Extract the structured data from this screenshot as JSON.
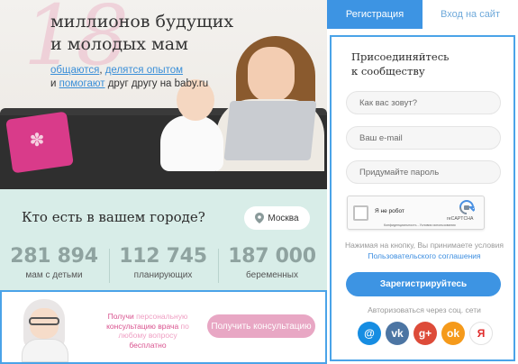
{
  "hero": {
    "number": "18",
    "title_line1": "миллионов будущих",
    "title_line2": "и молодых мам",
    "link_communicate": "общаются",
    "comma": ", ",
    "link_share": "делятся опытом",
    "and": "и ",
    "link_help": "помогают",
    "rest": " друг другу на baby.ru"
  },
  "city": {
    "title": "Кто есть в вашем городе?",
    "city_button": "Москва",
    "stats": [
      {
        "value": "281 894",
        "label": "мам с детьми"
      },
      {
        "value": "112 745",
        "label": "планирующих"
      },
      {
        "value": "187 000",
        "label": "беременных"
      }
    ]
  },
  "consult": {
    "get": "Получи ",
    "personal": "персональную",
    "consult_line": "консультацию врача",
    "by": " по",
    "any_question": "любому вопросу",
    "free": "бесплатно",
    "button": "Получить консультацию"
  },
  "auth": {
    "tabs": [
      "Регистрация",
      "Вход на сайт"
    ],
    "join_line1": "Присоединяйтесь",
    "join_line2": "к сообществу",
    "name_placeholder": "Как вас зовут?",
    "email_placeholder": "Ваш e-mail",
    "password_placeholder": "Придумайте пароль",
    "captcha_label": "Я не робот",
    "captcha_brand": "reCAPTCHA",
    "captcha_links": "Конфиденциальность - Условия использования",
    "terms_text": "Нажимая на кнопку, Вы принимаете условия ",
    "terms_link": "Пользовательского соглашения",
    "register_button": "Зарегистрируйтесь",
    "social_label": "Авторизоваться через соц. сети",
    "socials": [
      {
        "icon": "mail-ru-icon",
        "glyph": "@",
        "color": "#168de2"
      },
      {
        "icon": "vk-icon",
        "glyph": "vk",
        "color": "#4c75a3"
      },
      {
        "icon": "google-plus-icon",
        "glyph": "g+",
        "color": "#dd4b39"
      },
      {
        "icon": "odnoklassniki-icon",
        "glyph": "ok",
        "color": "#f59a1b"
      },
      {
        "icon": "yandex-icon",
        "glyph": "Я",
        "color": "#ffffff"
      }
    ]
  },
  "colors": {
    "accent": "#3d94e3",
    "pink": "#e8a7c4",
    "mint": "#d8ede8"
  }
}
